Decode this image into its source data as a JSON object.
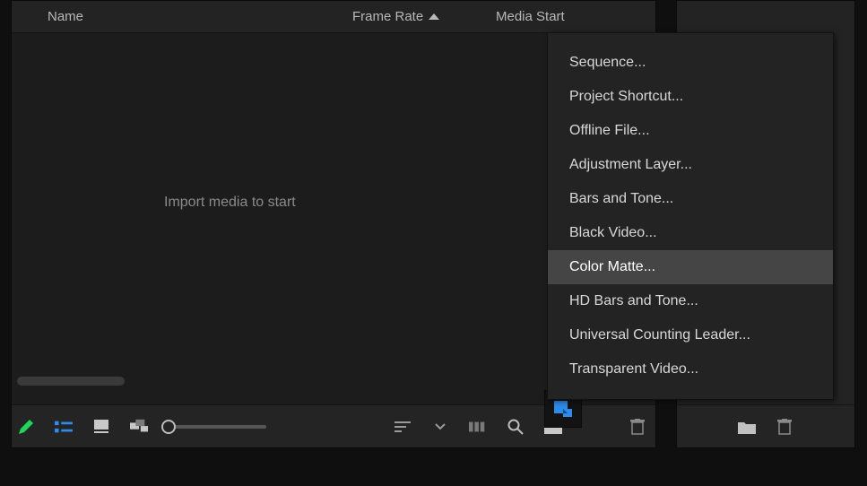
{
  "columns": {
    "name": "Name",
    "frame_rate": "Frame Rate",
    "media_start": "Media Start"
  },
  "bin": {
    "empty_message": "Import media to start"
  },
  "context_menu": {
    "items": [
      {
        "label": "Sequence..."
      },
      {
        "label": "Project Shortcut..."
      },
      {
        "label": "Offline File..."
      },
      {
        "label": "Adjustment Layer..."
      },
      {
        "label": "Bars and Tone..."
      },
      {
        "label": "Black Video..."
      },
      {
        "label": "Color Matte...",
        "hover": true
      },
      {
        "label": "HD Bars and Tone..."
      },
      {
        "label": "Universal Counting Leader..."
      },
      {
        "label": "Transparent Video..."
      }
    ]
  },
  "colors": {
    "accent_blue": "#2d8ceb",
    "accent_green": "#1fd65a"
  }
}
